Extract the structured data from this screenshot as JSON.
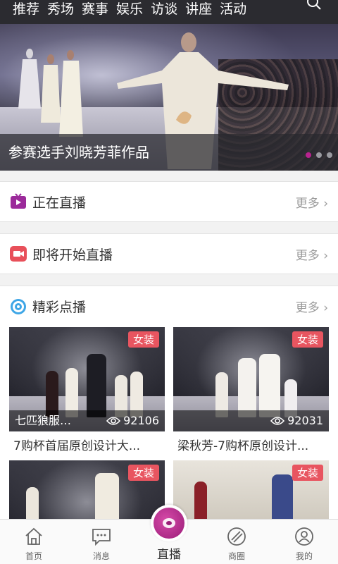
{
  "topnav": {
    "tabs": [
      "推荐",
      "秀场",
      "赛事",
      "娱乐",
      "访谈",
      "讲座",
      "活动"
    ],
    "search_icon": "search-icon"
  },
  "banner": {
    "caption": "参赛选手刘晓芳菲作品",
    "dots": 3,
    "active_dot": 0,
    "active_color": "#b8238f"
  },
  "sections": {
    "live_now": {
      "title": "正在直播",
      "more": "更多",
      "icon": "tv-icon",
      "color": "#9b2a9a"
    },
    "upcoming": {
      "title": "即将开始直播",
      "more": "更多",
      "icon": "video-camera-icon",
      "color": "#e8505a"
    },
    "vod": {
      "title": "精彩点播",
      "more": "更多",
      "icon": "disc-icon",
      "color": "#3ea6e6"
    }
  },
  "cards": [
    {
      "tag": "女装",
      "overlay_name": "七匹狼服…",
      "views": "92106",
      "title": "7购杯首届原创设计大..."
    },
    {
      "tag": "女装",
      "overlay_name": "",
      "views": "92031",
      "title": "梁秋芳-7购杯原创设计..."
    },
    {
      "tag": "女装",
      "overlay_name": "",
      "views": "",
      "title": ""
    },
    {
      "tag": "女装",
      "overlay_name": "",
      "views": "",
      "title": ""
    }
  ],
  "tabbar": {
    "items": [
      {
        "label": "首页",
        "icon": "home-icon"
      },
      {
        "label": "消息",
        "icon": "message-icon"
      },
      {
        "label": "直播",
        "icon": "live-icon"
      },
      {
        "label": "商圈",
        "icon": "business-circle-icon"
      },
      {
        "label": "我的",
        "icon": "user-icon"
      }
    ]
  }
}
